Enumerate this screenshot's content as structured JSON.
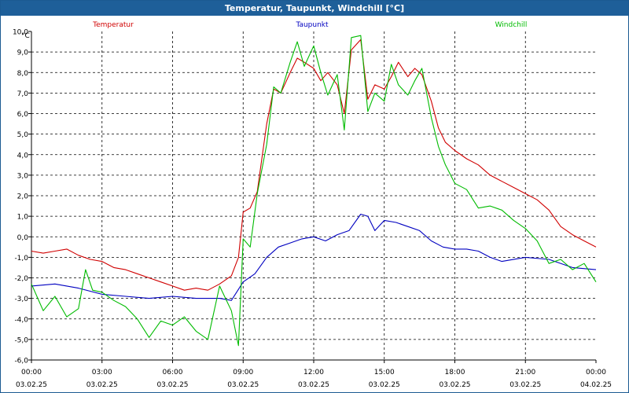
{
  "window": {
    "title": "Temperatur, Taupunkt, Windchill [°C]"
  },
  "chart_data": {
    "type": "line",
    "title": "Temperatur, Taupunkt, Windchill [°C]",
    "ylabel": "°C",
    "ylim": [
      -6,
      10
    ],
    "y_ticks": [
      "10,0",
      "9,0",
      "8,0",
      "7,0",
      "6,0",
      "5,0",
      "4,0",
      "3,0",
      "2,0",
      "1,0",
      "0,0",
      "-1,0",
      "-2,0",
      "-3,0",
      "-4,0",
      "-5,0",
      "-6,0"
    ],
    "x_unit": "hours since 03.02.25 00:00",
    "x_ticks": [
      {
        "time": "00:00",
        "date": "03.02.25"
      },
      {
        "time": "03:00",
        "date": "03.02.25"
      },
      {
        "time": "06:00",
        "date": "03.02.25"
      },
      {
        "time": "09:00",
        "date": "03.02.25"
      },
      {
        "time": "12:00",
        "date": "03.02.25"
      },
      {
        "time": "15:00",
        "date": "03.02.25"
      },
      {
        "time": "18:00",
        "date": "03.02.25"
      },
      {
        "time": "21:00",
        "date": "03.02.25"
      },
      {
        "time": "00:00",
        "date": "04.02.25"
      }
    ],
    "grid": true,
    "legend_position": "top",
    "series": [
      {
        "name": "Temperatur",
        "color": "#d00000",
        "points": [
          [
            0,
            -0.7
          ],
          [
            0.5,
            -0.8
          ],
          [
            1,
            -0.7
          ],
          [
            1.5,
            -0.6
          ],
          [
            2,
            -0.9
          ],
          [
            2.5,
            -1.1
          ],
          [
            3,
            -1.2
          ],
          [
            3.5,
            -1.5
          ],
          [
            4,
            -1.6
          ],
          [
            4.5,
            -1.8
          ],
          [
            5,
            -2.0
          ],
          [
            5.5,
            -2.2
          ],
          [
            6,
            -2.4
          ],
          [
            6.5,
            -2.6
          ],
          [
            7,
            -2.5
          ],
          [
            7.5,
            -2.6
          ],
          [
            8,
            -2.3
          ],
          [
            8.5,
            -1.9
          ],
          [
            8.8,
            -1.0
          ],
          [
            9,
            1.2
          ],
          [
            9.3,
            1.4
          ],
          [
            9.6,
            2.2
          ],
          [
            10,
            5.5
          ],
          [
            10.3,
            7.2
          ],
          [
            10.6,
            7.0
          ],
          [
            11,
            8.0
          ],
          [
            11.3,
            8.7
          ],
          [
            11.6,
            8.5
          ],
          [
            12,
            8.2
          ],
          [
            12.3,
            7.6
          ],
          [
            12.6,
            8.0
          ],
          [
            13,
            7.4
          ],
          [
            13.3,
            6.0
          ],
          [
            13.6,
            9.1
          ],
          [
            14,
            9.6
          ],
          [
            14.3,
            6.7
          ],
          [
            14.6,
            7.4
          ],
          [
            15,
            7.2
          ],
          [
            15.3,
            7.8
          ],
          [
            15.6,
            8.5
          ],
          [
            16,
            7.8
          ],
          [
            16.3,
            8.2
          ],
          [
            16.6,
            7.9
          ],
          [
            17,
            6.6
          ],
          [
            17.3,
            5.3
          ],
          [
            17.6,
            4.6
          ],
          [
            18,
            4.2
          ],
          [
            18.5,
            3.8
          ],
          [
            19,
            3.5
          ],
          [
            19.5,
            3.0
          ],
          [
            20,
            2.7
          ],
          [
            20.5,
            2.4
          ],
          [
            21,
            2.1
          ],
          [
            21.5,
            1.8
          ],
          [
            22,
            1.3
          ],
          [
            22.5,
            0.5
          ],
          [
            23,
            0.1
          ],
          [
            23.5,
            -0.2
          ],
          [
            24,
            -0.5
          ]
        ]
      },
      {
        "name": "Taupunkt",
        "color": "#0000c0",
        "points": [
          [
            0,
            -2.4
          ],
          [
            1,
            -2.3
          ],
          [
            2,
            -2.5
          ],
          [
            3,
            -2.8
          ],
          [
            4,
            -2.9
          ],
          [
            5,
            -3.0
          ],
          [
            6,
            -2.9
          ],
          [
            7,
            -3.0
          ],
          [
            8,
            -3.0
          ],
          [
            8.5,
            -3.1
          ],
          [
            9,
            -2.2
          ],
          [
            9.5,
            -1.8
          ],
          [
            10,
            -1.0
          ],
          [
            10.5,
            -0.5
          ],
          [
            11,
            -0.3
          ],
          [
            11.5,
            -0.1
          ],
          [
            12,
            0.0
          ],
          [
            12.5,
            -0.2
          ],
          [
            13,
            0.1
          ],
          [
            13.5,
            0.3
          ],
          [
            14,
            1.1
          ],
          [
            14.3,
            1.0
          ],
          [
            14.6,
            0.3
          ],
          [
            15,
            0.8
          ],
          [
            15.5,
            0.7
          ],
          [
            16,
            0.5
          ],
          [
            16.5,
            0.3
          ],
          [
            17,
            -0.2
          ],
          [
            17.5,
            -0.5
          ],
          [
            18,
            -0.6
          ],
          [
            18.5,
            -0.6
          ],
          [
            19,
            -0.7
          ],
          [
            19.5,
            -1.0
          ],
          [
            20,
            -1.2
          ],
          [
            21,
            -1.0
          ],
          [
            22,
            -1.1
          ],
          [
            23,
            -1.5
          ],
          [
            24,
            -1.6
          ]
        ]
      },
      {
        "name": "Windchill",
        "color": "#00bb00",
        "points": [
          [
            0,
            -2.3
          ],
          [
            0.5,
            -3.6
          ],
          [
            1,
            -2.9
          ],
          [
            1.5,
            -3.9
          ],
          [
            2,
            -3.5
          ],
          [
            2.3,
            -1.6
          ],
          [
            2.6,
            -2.6
          ],
          [
            3,
            -2.7
          ],
          [
            3.5,
            -3.1
          ],
          [
            4,
            -3.4
          ],
          [
            4.5,
            -4.0
          ],
          [
            5,
            -4.9
          ],
          [
            5.5,
            -4.1
          ],
          [
            6,
            -4.3
          ],
          [
            6.5,
            -3.9
          ],
          [
            7,
            -4.6
          ],
          [
            7.5,
            -5.0
          ],
          [
            8,
            -2.4
          ],
          [
            8.5,
            -3.6
          ],
          [
            8.8,
            -5.3
          ],
          [
            9,
            -0.1
          ],
          [
            9.3,
            -0.5
          ],
          [
            9.6,
            2.1
          ],
          [
            10,
            4.5
          ],
          [
            10.3,
            7.3
          ],
          [
            10.6,
            7.0
          ],
          [
            11,
            8.5
          ],
          [
            11.3,
            9.5
          ],
          [
            11.6,
            8.3
          ],
          [
            12,
            9.3
          ],
          [
            12.3,
            8.0
          ],
          [
            12.6,
            6.9
          ],
          [
            13,
            7.9
          ],
          [
            13.3,
            5.2
          ],
          [
            13.6,
            9.7
          ],
          [
            14,
            9.8
          ],
          [
            14.3,
            6.1
          ],
          [
            14.6,
            7.0
          ],
          [
            15,
            6.6
          ],
          [
            15.3,
            8.4
          ],
          [
            15.6,
            7.4
          ],
          [
            16,
            6.9
          ],
          [
            16.3,
            7.6
          ],
          [
            16.6,
            8.2
          ],
          [
            17,
            5.8
          ],
          [
            17.3,
            4.4
          ],
          [
            17.6,
            3.5
          ],
          [
            18,
            2.6
          ],
          [
            18.5,
            2.3
          ],
          [
            19,
            1.4
          ],
          [
            19.5,
            1.5
          ],
          [
            20,
            1.3
          ],
          [
            20.5,
            0.8
          ],
          [
            21,
            0.4
          ],
          [
            21.5,
            -0.2
          ],
          [
            22,
            -1.3
          ],
          [
            22.5,
            -1.1
          ],
          [
            23,
            -1.6
          ],
          [
            23.5,
            -1.3
          ],
          [
            24,
            -2.2
          ]
        ]
      }
    ]
  }
}
